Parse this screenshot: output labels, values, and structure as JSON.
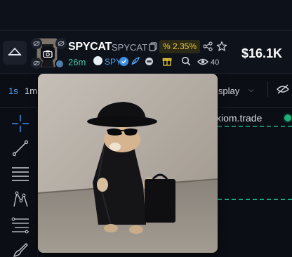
{
  "token": {
    "name": "SPYCAT",
    "ticker": "SPYCAT",
    "change_pct": "% 2.35%",
    "price": "$16.1K",
    "age": "26m",
    "link_label": "SPY",
    "views": "40"
  },
  "toolbar": {
    "timeframe_1s": "1s",
    "timeframe_1m": "1m",
    "display_label": "isplay"
  },
  "chart": {
    "watermark": "xiom.trade"
  },
  "colors": {
    "accent_blue": "#4da1f0",
    "green": "#19b27b",
    "yellow": "#f0cc39",
    "background": "#0b0e15"
  },
  "icons": [
    "home-icon",
    "eye-off-icon",
    "camera-icon",
    "copy-icon",
    "share-icon",
    "star-icon",
    "verified-icon",
    "feather-icon",
    "gift-icon",
    "search-icon",
    "eye-icon",
    "crosshair-icon",
    "trendline-icon",
    "horizontal-lines-icon",
    "pattern-icon",
    "fib-icon",
    "brush-icon"
  ]
}
